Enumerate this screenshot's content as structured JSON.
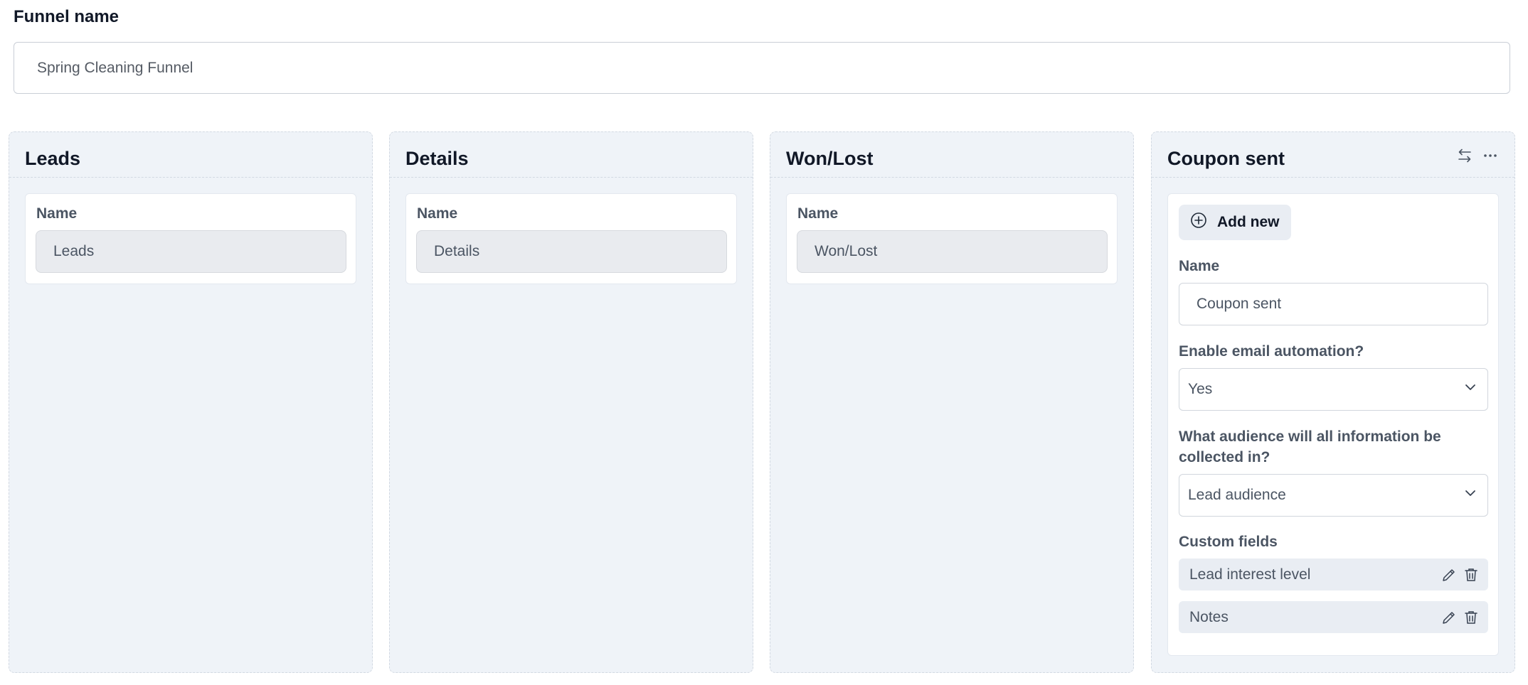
{
  "funnel": {
    "label": "Funnel name",
    "value": "Spring Cleaning Funnel"
  },
  "columns": [
    {
      "title": "Leads",
      "name_label": "Name",
      "name_value": "Leads"
    },
    {
      "title": "Details",
      "name_label": "Name",
      "name_value": "Details"
    },
    {
      "title": "Won/Lost",
      "name_label": "Name",
      "name_value": "Won/Lost"
    }
  ],
  "active_column": {
    "title": "Coupon sent",
    "add_new_label": "Add new",
    "name_label": "Name",
    "name_value": "Coupon sent",
    "email_automation_label": "Enable email automation?",
    "email_automation_value": "Yes",
    "audience_label": "What audience will all information be collected in?",
    "audience_value": "Lead audience",
    "custom_fields_label": "Custom fields",
    "custom_fields": [
      {
        "label": "Lead interest level"
      },
      {
        "label": "Notes"
      }
    ]
  },
  "icons": {
    "swap": "swap-arrows-icon",
    "more": "more-horizontal-icon",
    "add": "plus-circle-icon",
    "chevron": "chevron-down-icon",
    "edit": "pencil-icon",
    "delete": "trash-icon"
  },
  "colors": {
    "column_bg": "#eff3f8",
    "card_bg": "#ffffff",
    "disabled_input_bg": "#e9ebef",
    "text_primary": "#111827",
    "text_secondary": "#4b5563"
  }
}
